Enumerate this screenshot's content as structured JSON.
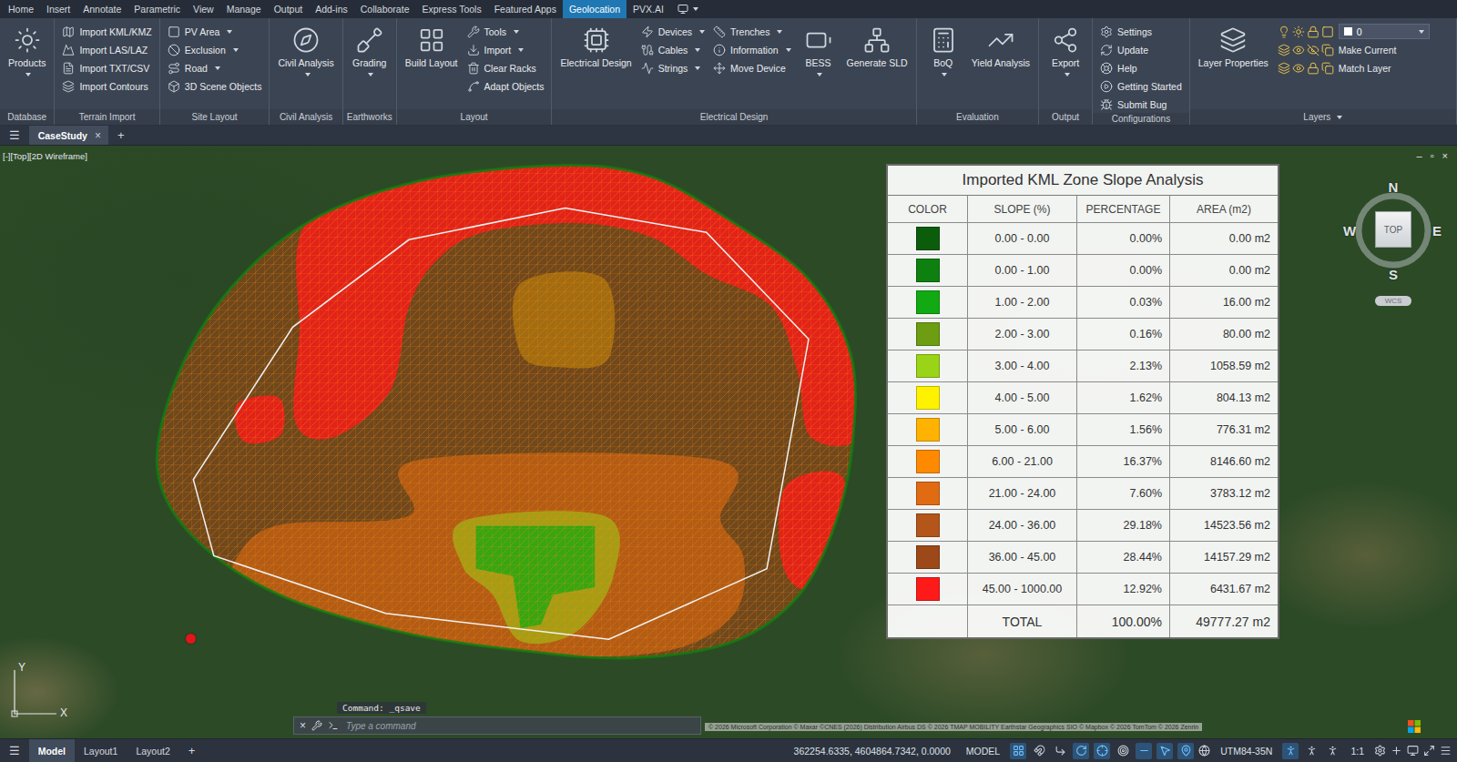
{
  "menu_bar": {
    "tabs": [
      {
        "label": "Home",
        "selected": false
      },
      {
        "label": "Insert",
        "selected": false
      },
      {
        "label": "Annotate",
        "selected": false
      },
      {
        "label": "Parametric",
        "selected": false
      },
      {
        "label": "View",
        "selected": false
      },
      {
        "label": "Manage",
        "selected": false
      },
      {
        "label": "Output",
        "selected": false
      },
      {
        "label": "Add-ins",
        "selected": false
      },
      {
        "label": "Collaborate",
        "selected": false
      },
      {
        "label": "Express Tools",
        "selected": false
      },
      {
        "label": "Featured Apps",
        "selected": false
      },
      {
        "label": "Geolocation",
        "selected": true
      },
      {
        "label": "PVX.AI",
        "selected": false
      }
    ]
  },
  "ribbon": {
    "groups": [
      {
        "label": "Database",
        "caret": false,
        "items": [
          {
            "kind": "large",
            "label": "Products",
            "dropdown": true
          }
        ]
      },
      {
        "label": "Terrain Import",
        "caret": false,
        "items": [
          {
            "kind": "column",
            "rows": [
              {
                "label": "Import KML/KMZ",
                "dropdown": false
              },
              {
                "label": "Import LAS/LAZ",
                "dropdown": false
              },
              {
                "label": "Import TXT/CSV",
                "dropdown": false
              },
              {
                "label": "Import Contours",
                "dropdown": false
              }
            ]
          }
        ]
      },
      {
        "label": "Site Layout",
        "caret": false,
        "items": [
          {
            "kind": "column",
            "rows": [
              {
                "label": "PV Area",
                "dropdown": true
              },
              {
                "label": "Exclusion",
                "dropdown": true
              },
              {
                "label": "Road",
                "dropdown": true
              },
              {
                "label": "3D Scene Objects",
                "dropdown": false
              }
            ]
          }
        ]
      },
      {
        "label": "Civil Analysis",
        "caret": false,
        "items": [
          {
            "kind": "large",
            "label": "Civil Analysis",
            "dropdown": true
          }
        ]
      },
      {
        "label": "Earthworks",
        "caret": false,
        "items": [
          {
            "kind": "large",
            "label": "Grading",
            "dropdown": true
          }
        ]
      },
      {
        "label": "Layout",
        "caret": false,
        "items": [
          {
            "kind": "large",
            "label": "Build Layout",
            "dropdown": false
          },
          {
            "kind": "column",
            "rows": [
              {
                "label": "Tools",
                "dropdown": true
              },
              {
                "label": "Import",
                "dropdown": true
              },
              {
                "label": "Clear Racks",
                "dropdown": false
              },
              {
                "label": "Adapt Objects",
                "dropdown": false
              }
            ]
          }
        ]
      },
      {
        "label": "Electrical Design",
        "caret": false,
        "items": [
          {
            "kind": "large",
            "label": "Electrical Design",
            "dropdown": false
          },
          {
            "kind": "column",
            "rows": [
              {
                "label": "Devices",
                "dropdown": true
              },
              {
                "label": "Cables",
                "dropdown": true
              },
              {
                "label": "Strings",
                "dropdown": true
              }
            ]
          },
          {
            "kind": "column",
            "rows": [
              {
                "label": "Trenches",
                "dropdown": true
              },
              {
                "label": "Information",
                "dropdown": true
              },
              {
                "label": "Move Device",
                "dropdown": false
              }
            ]
          },
          {
            "kind": "large",
            "label": "BESS",
            "dropdown": true
          },
          {
            "kind": "large",
            "label": "Generate SLD",
            "dropdown": false
          }
        ]
      },
      {
        "label": "Evaluation",
        "caret": false,
        "items": [
          {
            "kind": "large",
            "label": "BoQ",
            "dropdown": true
          },
          {
            "kind": "large",
            "label": "Yield Analysis",
            "dropdown": false
          }
        ]
      },
      {
        "label": "Output",
        "caret": false,
        "items": [
          {
            "kind": "large",
            "label": "Export",
            "dropdown": true
          }
        ]
      },
      {
        "label": "Configurations",
        "caret": false,
        "items": [
          {
            "kind": "column",
            "rows": [
              {
                "label": "Settings",
                "dropdown": false
              },
              {
                "label": "Update",
                "dropdown": false
              },
              {
                "label": "Help",
                "dropdown": false
              },
              {
                "label": "Getting Started",
                "dropdown": false
              },
              {
                "label": "Submit Bug",
                "dropdown": false
              }
            ]
          }
        ]
      },
      {
        "label": "Layers",
        "caret": true,
        "items": [
          {
            "kind": "large",
            "label": "Layer Properties",
            "dropdown": false
          },
          {
            "kind": "layer-tools",
            "value": "0",
            "actions": [
              "Make Current",
              "Match Layer"
            ]
          }
        ]
      }
    ]
  },
  "file_tabs": {
    "menu": "☰",
    "tabs": [
      {
        "label": "CaseStudy",
        "selected": true,
        "close": "×"
      }
    ],
    "add": "+"
  },
  "viewport": {
    "label": "[-][Top][2D Wireframe]",
    "window_controls": [
      "–",
      "▫",
      "×"
    ],
    "legend": {
      "title": "Imported KML Zone Slope Analysis",
      "columns": [
        "COLOR",
        "SLOPE (%)",
        "PERCENTAGE",
        "AREA (m2)"
      ],
      "rows": [
        {
          "slope": "0.00 - 0.00",
          "percentage": "0.00%",
          "area": "0.00 m2",
          "color": "#0b5d0b"
        },
        {
          "slope": "0.00 - 1.00",
          "percentage": "0.00%",
          "area": "0.00 m2",
          "color": "#0e8010"
        },
        {
          "slope": "1.00 - 2.00",
          "percentage": "0.03%",
          "area": "16.00 m2",
          "color": "#12aa12"
        },
        {
          "slope": "2.00 - 3.00",
          "percentage": "0.16%",
          "area": "80.00 m2",
          "color": "#6c9d12"
        },
        {
          "slope": "3.00 - 4.00",
          "percentage": "2.13%",
          "area": "1058.59 m2",
          "color": "#9ad417"
        },
        {
          "slope": "4.00 - 5.00",
          "percentage": "1.62%",
          "area": "804.13 m2",
          "color": "#fff200"
        },
        {
          "slope": "5.00 - 6.00",
          "percentage": "1.56%",
          "area": "776.31 m2",
          "color": "#ffb300"
        },
        {
          "slope": "6.00 - 21.00",
          "percentage": "16.37%",
          "area": "8146.60 m2",
          "color": "#ff8a00"
        },
        {
          "slope": "21.00 - 24.00",
          "percentage": "7.60%",
          "area": "3783.12 m2",
          "color": "#e06b12"
        },
        {
          "slope": "24.00 - 36.00",
          "percentage": "29.18%",
          "area": "14523.56 m2",
          "color": "#b4561a"
        },
        {
          "slope": "36.00 - 45.00",
          "percentage": "28.44%",
          "area": "14157.29 m2",
          "color": "#9c4818"
        },
        {
          "slope": "45.00 - 1000.00",
          "percentage": "12.92%",
          "area": "6431.67 m2",
          "color": "#ff1a1a"
        }
      ],
      "total": {
        "label": "TOTAL",
        "percentage": "100.00%",
        "area": "49777.27 m2"
      }
    },
    "view_cube": {
      "north": "N",
      "west": "W",
      "east": "E",
      "south": "S",
      "face": "TOP",
      "ucs": "WCS"
    },
    "ucs_icon": {
      "x": "X",
      "y": "Y"
    },
    "command_line": {
      "history": "Command: _qsave",
      "close": "×",
      "placeholder": "Type a command"
    },
    "attribution": "© 2026 Microsoft Corporation © Maxar ©CNES (2026) Distribution Airbus DS © 2026 TMAP MOBILITY Earthstar Geographics SIO © Mapbox © 2026 TomTom © 2026 Zenrin"
  },
  "status_bar": {
    "menu": "☰",
    "tabs": [
      {
        "label": "Model",
        "selected": true
      },
      {
        "label": "Layout1",
        "selected": false
      },
      {
        "label": "Layout2",
        "selected": false
      }
    ],
    "add": "+",
    "coordinates": "362254.6335, 4604864.7342, 0.0000",
    "space": "MODEL",
    "toggles": [
      {
        "kind": "grid",
        "on": true
      },
      {
        "kind": "snap",
        "on": false
      },
      {
        "kind": "ortho",
        "on": false
      },
      {
        "kind": "polar",
        "on": true
      },
      {
        "kind": "osnap",
        "on": true
      },
      {
        "kind": "tracking",
        "on": false
      },
      {
        "kind": "lineweight",
        "on": true
      },
      {
        "kind": "selection",
        "on": true
      },
      {
        "kind": "geolocation",
        "on": true
      }
    ],
    "coordinate_system": "UTM84-35N",
    "annotation": [
      {
        "kind": "visibility",
        "on": true
      },
      {
        "kind": "autoscale",
        "on": false
      },
      {
        "kind": "annoscale",
        "on": false
      }
    ],
    "scale": "1:1"
  }
}
